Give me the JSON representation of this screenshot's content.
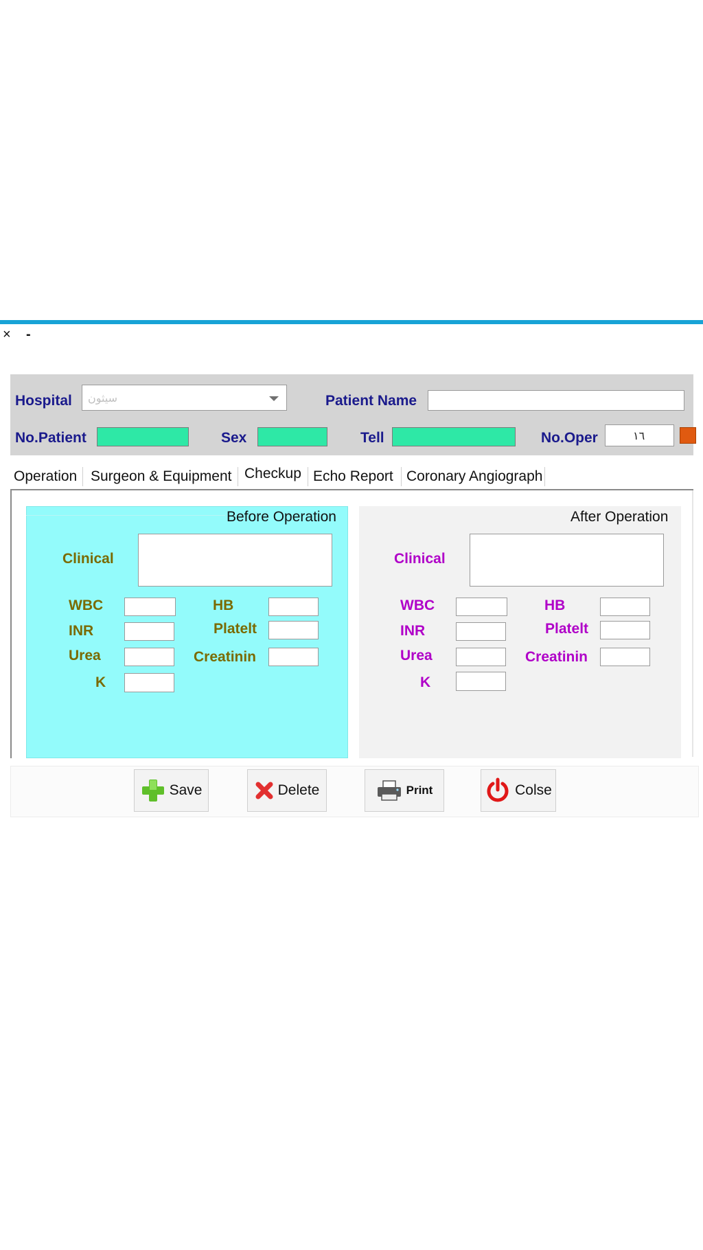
{
  "window": {
    "close_glyph": "×",
    "minimize_glyph": "-"
  },
  "header": {
    "hospital_label": "Hospital",
    "hospital_value": "سيثون",
    "patient_name_label": "Patient Name",
    "patient_name_value": "",
    "no_patient_label": "No.Patient",
    "sex_label": "Sex",
    "tell_label": "Tell",
    "no_oper_label": "No.Oper",
    "no_oper_value": "١٦"
  },
  "tabs": [
    {
      "label": "Operation"
    },
    {
      "label": "Surgeon & Equipment"
    },
    {
      "label": "Checkup"
    },
    {
      "label": "Echo Report"
    },
    {
      "label": "Coronary Angiograph"
    }
  ],
  "active_tab": "Checkup",
  "before": {
    "title": "Before Operation",
    "clinical": "Clinical",
    "wbc": "WBC",
    "hb": "HB",
    "inr": "INR",
    "platelt": "Platelt",
    "urea": "Urea",
    "creatinin": "Creatinin",
    "k": "K"
  },
  "after": {
    "title": "After Operation",
    "clinical": "Clinical",
    "wbc": "WBC",
    "hb": "HB",
    "inr": "INR",
    "platelt": "Platelt",
    "urea": "Urea",
    "creatinin": "Creatinin",
    "k": "K"
  },
  "buttons": {
    "save": "Save",
    "delete": "Delete",
    "print": "Print",
    "close": "Colse"
  },
  "colors": {
    "accent_bar": "#18a3d6",
    "before_panel": "#93fbfb",
    "green_field": "#2ee8a6",
    "navy_label": "#1a1a8c",
    "olive_label": "#7a6a00",
    "magenta_label": "#b000c8"
  },
  "icons": {
    "save": "plus-icon",
    "delete": "x-icon",
    "print": "printer-icon",
    "close": "power-icon",
    "hospital_dropdown": "chevron-down-icon"
  }
}
